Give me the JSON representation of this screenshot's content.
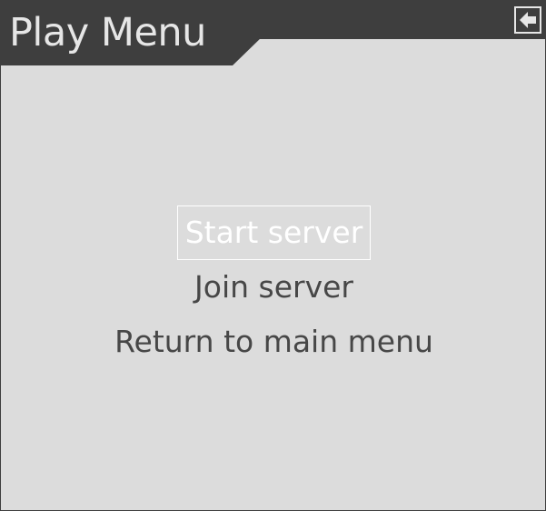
{
  "window": {
    "title": "Play Menu"
  },
  "header": {
    "back_icon": "arrow-left-icon"
  },
  "menu": {
    "items": [
      {
        "label": "Start server",
        "selected": true
      },
      {
        "label": "Join server",
        "selected": false
      },
      {
        "label": "Return to main menu",
        "selected": false
      }
    ]
  },
  "colors": {
    "background": "#dcdcdc",
    "header": "#3e3e3e",
    "text": "#474747",
    "highlight": "#ffffff"
  }
}
